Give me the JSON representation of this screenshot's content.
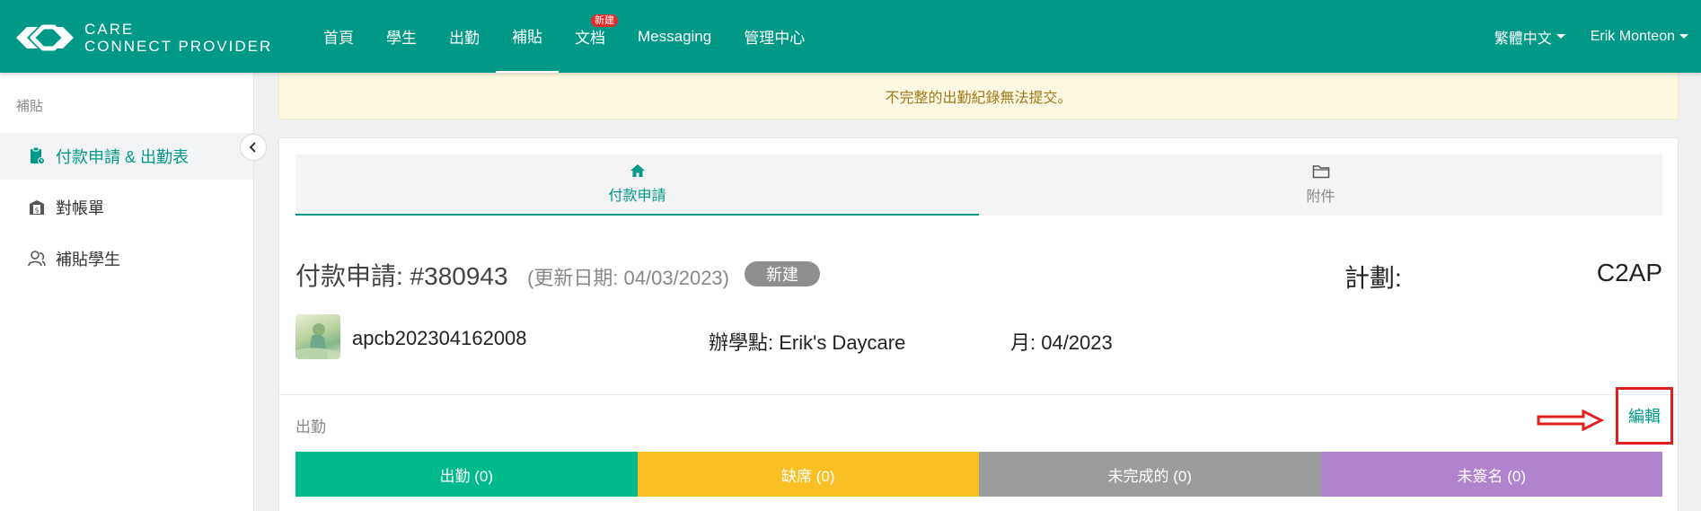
{
  "topnav": {
    "logo_line1": "CARE",
    "logo_line2": "CONNECT PROVIDER",
    "items": [
      {
        "label": "首頁"
      },
      {
        "label": "學生"
      },
      {
        "label": "出勤"
      },
      {
        "label": "補貼"
      },
      {
        "label": "文档",
        "badge": "新建"
      },
      {
        "label": "Messaging"
      },
      {
        "label": "管理中心"
      }
    ],
    "active_index": 3,
    "language": "繁體中文",
    "user": "Erik Monteon",
    "colors": {
      "brand": "#009987"
    }
  },
  "sidebar": {
    "heading": "補貼",
    "items": [
      {
        "label": "付款申請 & 出勤表",
        "icon": "clipboard-icon"
      },
      {
        "label": "對帳單",
        "icon": "statement-icon"
      },
      {
        "label": "補貼學生",
        "icon": "student-icon"
      }
    ],
    "active_index": 0
  },
  "alert": {
    "text": "不完整的出勤紀錄無法提交。"
  },
  "tabs": [
    {
      "label": "付款申請",
      "icon": "home-icon"
    },
    {
      "label": "附件",
      "icon": "folder-icon"
    }
  ],
  "request": {
    "title": "付款申請: #380943",
    "updated": "(更新日期: 04/03/2023)",
    "status": "新建",
    "plan_label": "計劃:",
    "plan_value": "C2AP"
  },
  "info": {
    "id": "apcb202304162008",
    "site": "辦學點: Erik's Daycare",
    "month": "月: 04/2023"
  },
  "attendance": {
    "label": "出勤",
    "edit_label": "編輯",
    "stats": [
      {
        "label": "出勤 (0)",
        "color": "#00ba8c"
      },
      {
        "label": "缺席 (0)",
        "color": "#fbbf26"
      },
      {
        "label": "未完成的 (0)",
        "color": "#9c9c9c"
      },
      {
        "label": "未簽名 (0)",
        "color": "#b083cf"
      }
    ]
  }
}
